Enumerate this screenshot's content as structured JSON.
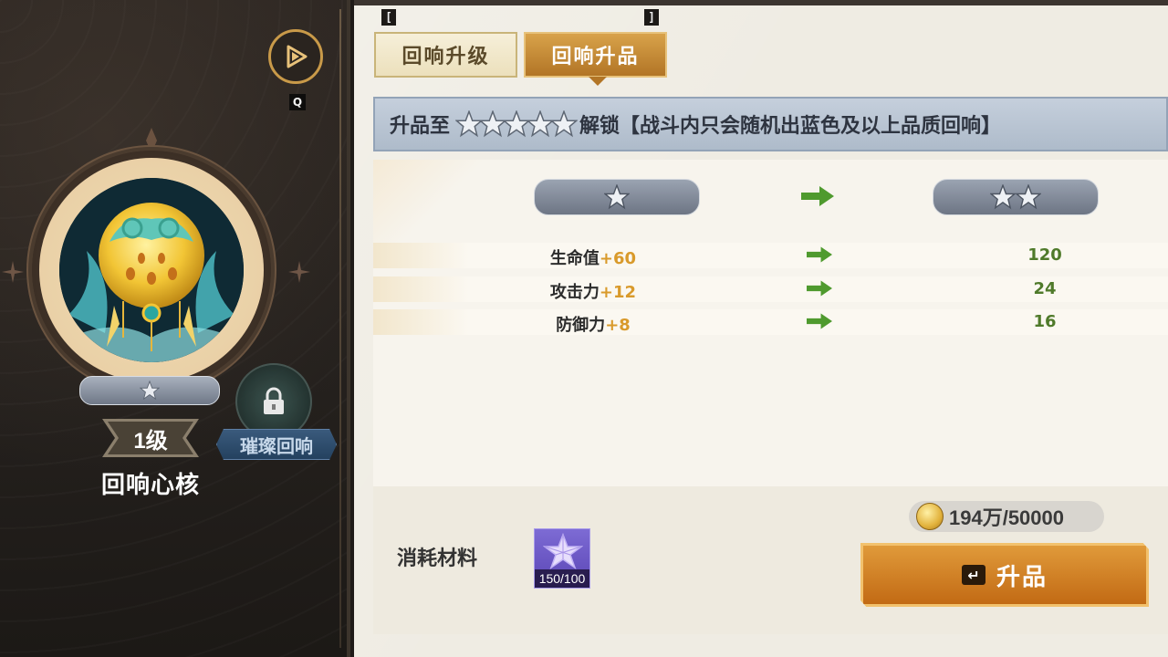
{
  "hotkeys": {
    "open_key": "Q",
    "tab_prev": "[",
    "tab_next": "]"
  },
  "left": {
    "level": "1级",
    "core_name": "回响心核",
    "locked_label": "璀璨回响",
    "current_stars": 1
  },
  "tabs": [
    {
      "label": "回响升级",
      "active": false
    },
    {
      "label": "回响升品",
      "active": true
    }
  ],
  "unlock": {
    "prefix": "升品至",
    "target_stars": 5,
    "suffix": "解锁【战斗内只会随机出蓝色及以上品质回响】"
  },
  "compare": {
    "from_stars": 1,
    "to_stars": 2
  },
  "stats": [
    {
      "label": "生命值",
      "plus": "+60",
      "next": "120"
    },
    {
      "label": "攻击力",
      "plus": "+12",
      "next": "24"
    },
    {
      "label": "防御力",
      "plus": "+8",
      "next": "16"
    }
  ],
  "material": {
    "label": "消耗材料",
    "count": "150/100"
  },
  "currency": {
    "text": "194万/50000"
  },
  "upgrade": {
    "enter_key": "↵",
    "label": "升品"
  },
  "colors": {
    "accent": "#d99a2b",
    "green": "#4f7a2a",
    "button": "#c26a14"
  },
  "icons": [
    "play-icon",
    "star-icon",
    "lock-icon",
    "arrow-right-icon",
    "coin-icon",
    "crystal-star-icon",
    "enter-key-icon"
  ]
}
